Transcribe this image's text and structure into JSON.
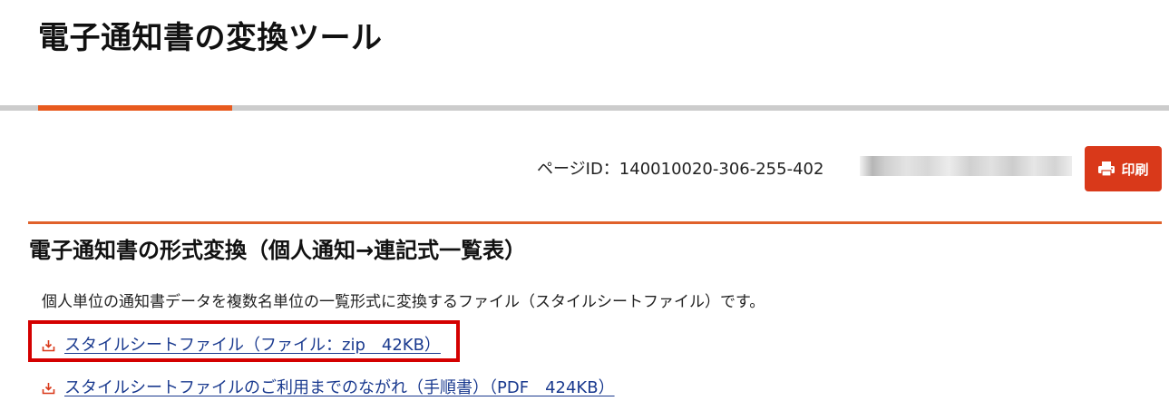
{
  "header": {
    "title": "電子通知書の変換ツール"
  },
  "meta": {
    "page_id": "ページID：140010020-306-255-402"
  },
  "toolbar": {
    "print_label": "印刷"
  },
  "section": {
    "heading": "電子通知書の形式変換（個人通知→連記式一覧表）",
    "description": "個人単位の通知書データを複数名単位の一覧形式に変換するファイル（スタイルシートファイル）です。"
  },
  "links": [
    {
      "label": "スタイルシートファイル（ファイル：zip　42KB）",
      "icon": "download-icon"
    },
    {
      "label": "スタイルシートファイルのご利用までのながれ（手順書）（PDF　424KB）",
      "icon": "download-icon"
    }
  ],
  "colors": {
    "accent": "#e85a1e",
    "print_button": "#d9391a",
    "link": "#1a3a8f",
    "highlight": "#d40000"
  }
}
